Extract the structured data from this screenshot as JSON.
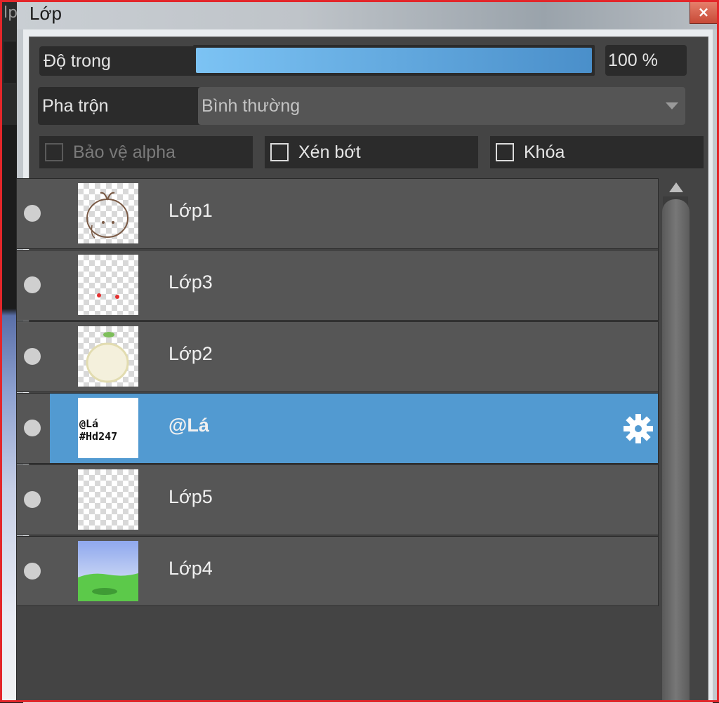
{
  "window": {
    "title": "Lớp",
    "close_symbol": "×",
    "left_fragment": "lp"
  },
  "opacity": {
    "label": "Độ trong",
    "value_text": "100 %",
    "value": 100
  },
  "blend": {
    "label": "Pha trộn",
    "selected": "Bình thường"
  },
  "options": {
    "protect_alpha": {
      "label": "Bảo vệ alpha",
      "checked": false,
      "disabled": true
    },
    "clip": {
      "label": "Xén bớt",
      "checked": false,
      "disabled": false
    },
    "lock": {
      "label": "Khóa",
      "checked": false,
      "disabled": false
    }
  },
  "layers": [
    {
      "name": "Lớp1",
      "thumb": "face-sketch",
      "selected": false
    },
    {
      "name": "Lớp3",
      "thumb": "red-dots",
      "selected": false
    },
    {
      "name": "Lớp2",
      "thumb": "cream-body",
      "selected": false
    },
    {
      "name": "@Lá",
      "thumb": "text-stamp",
      "selected": true,
      "thumb_text": [
        "@Lá",
        "#Hd247"
      ]
    },
    {
      "name": "Lớp5",
      "thumb": "empty",
      "selected": false
    },
    {
      "name": "Lớp4",
      "thumb": "sky-grass",
      "selected": false
    }
  ],
  "colors": {
    "selection": "#529ad1",
    "frame": "#e3262a"
  }
}
